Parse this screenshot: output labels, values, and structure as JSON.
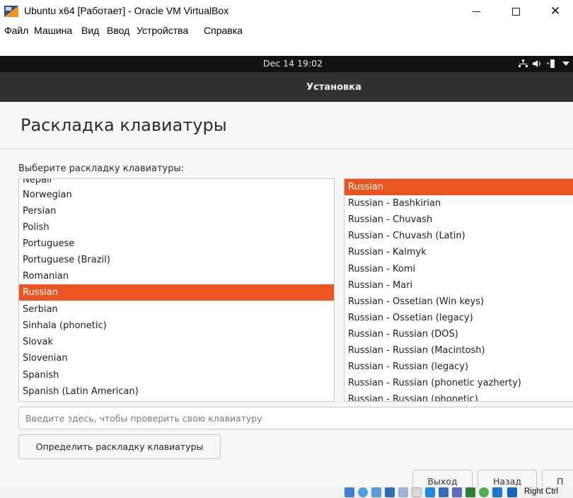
{
  "window": {
    "title": "Ubuntu x64 [Работает] - Oracle VM VirtualBox",
    "minimize": "—",
    "close": "✕"
  },
  "menubar": {
    "items": [
      "Файл",
      "Машина",
      "Вид",
      "Ввод",
      "Устройства",
      "Справка"
    ]
  },
  "gnome_bar": {
    "clock": "Dec 14  19:02"
  },
  "installer": {
    "header_title": "Установка",
    "page_heading": "Раскладка клавиатуры",
    "prompt": "Выберите раскладку клавиатуры:",
    "layouts": [
      "Nepali",
      "Norwegian",
      "Persian",
      "Polish",
      "Portuguese",
      "Portuguese (Brazil)",
      "Romanian",
      "Russian",
      "Serbian",
      "Sinhala (phonetic)",
      "Slovak",
      "Slovenian",
      "Spanish",
      "Spanish (Latin American)"
    ],
    "selected_layout": "Russian",
    "variants": [
      "Russian",
      "Russian - Bashkirian",
      "Russian - Chuvash",
      "Russian - Chuvash (Latin)",
      "Russian - Kalmyk",
      "Russian - Komi",
      "Russian - Mari",
      "Russian - Ossetian (Win keys)",
      "Russian - Ossetian (legacy)",
      "Russian - Russian (DOS)",
      "Russian - Russian (Macintosh)",
      "Russian - Russian (legacy)",
      "Russian - Russian (phonetic yazherty)",
      "Russian - Russian (phonetic)"
    ],
    "selected_variant": "Russian",
    "test_placeholder": "Введите здесь, чтобы проверить свою клавиатуру",
    "detect_button": "Определить раскладку клавиатуры",
    "quit_button": "Выход",
    "back_button": "Назад",
    "next_button": "П"
  },
  "statusbar": {
    "host_key": "Right Ctrl"
  },
  "colors": {
    "accent": "#e95420",
    "header_bg": "#323232",
    "topbar_bg": "#121212"
  }
}
